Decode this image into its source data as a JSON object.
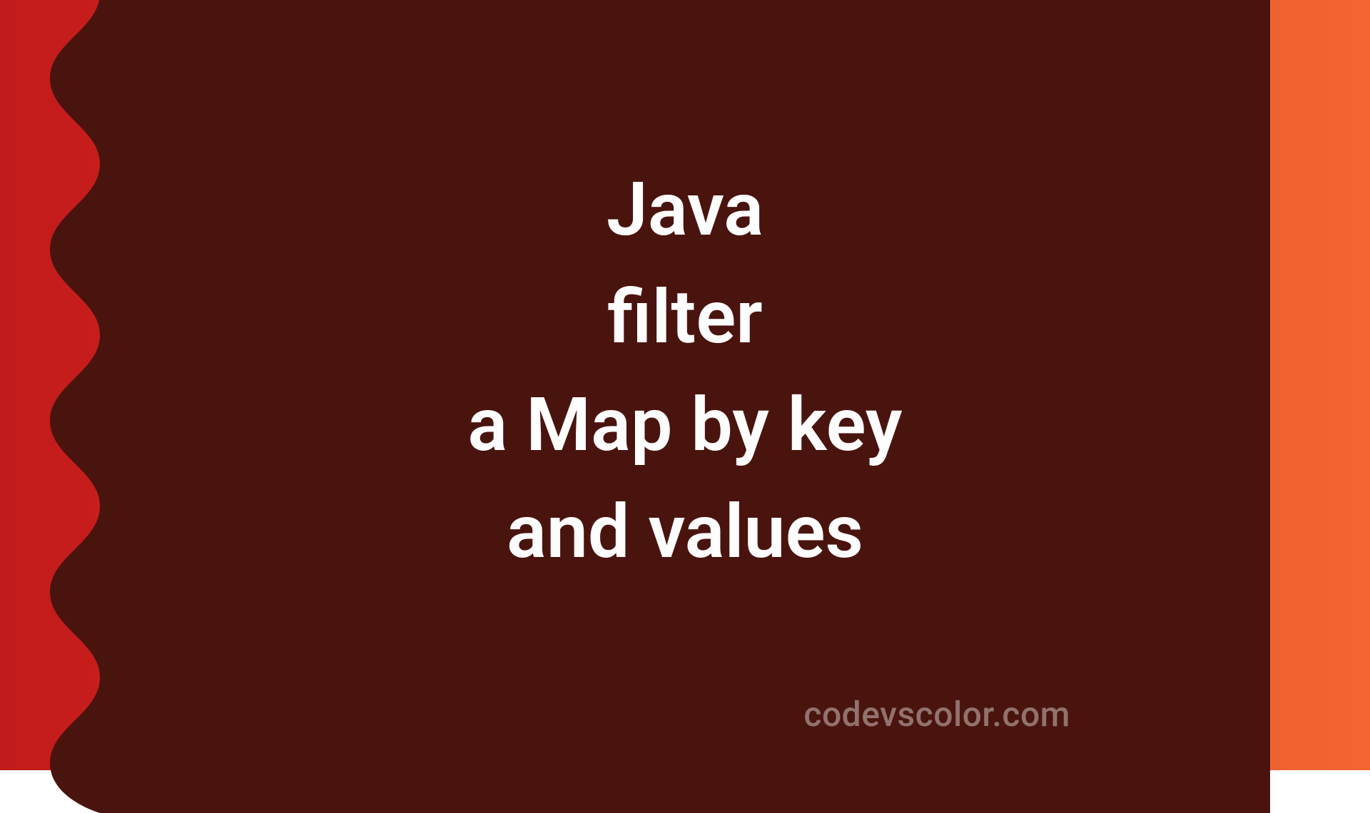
{
  "title": {
    "line1": "Java",
    "line2": "filter",
    "line3": "a Map by key",
    "line4": "and values"
  },
  "watermark": "codevscolor.com",
  "colors": {
    "blob": "#4a140e",
    "gradient_start": "#c21b1b",
    "gradient_end": "#f26430",
    "text": "#fdfdfd"
  }
}
